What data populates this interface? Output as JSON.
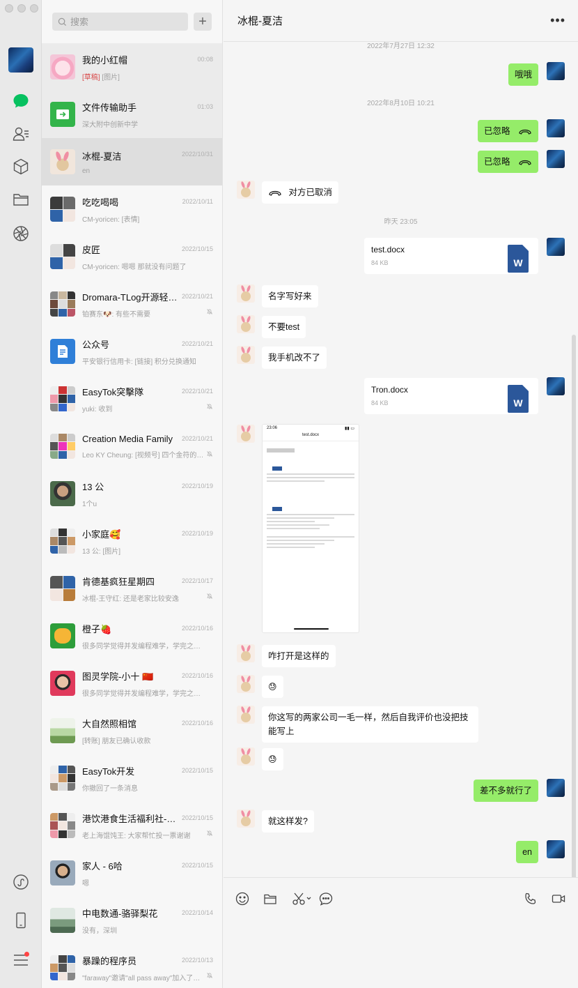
{
  "sidebar": {
    "icons": [
      "avatar",
      "chat-icon",
      "contacts-icon",
      "favorites-icon",
      "folder-icon",
      "moments-icon",
      "mini-program-icon",
      "phone-icon",
      "menu-icon"
    ]
  },
  "search": {
    "placeholder": "搜索",
    "add_label": "+"
  },
  "conversations": [
    {
      "name": "我的小红帽",
      "draft": "[草稿]",
      "preview": " [图片]",
      "time": "00:08"
    },
    {
      "name": "文件传输助手",
      "preview": "深大附中创新中学",
      "time": "01:03"
    },
    {
      "name": "冰棍-夏洁",
      "preview": "en",
      "time": "2022/10/31"
    },
    {
      "name": "吃吃喝喝",
      "preview": "CM-yoricen: [表情]",
      "time": "2022/10/11"
    },
    {
      "name": "皮匠",
      "preview": "CM-yoricen: 嗯嗯 那就没有问题了",
      "time": "2022/10/15"
    },
    {
      "name": "Dromara-TLog开源轻量…",
      "preview": "铂赛东🐶: 有些不需要",
      "time": "2022/10/21"
    },
    {
      "name": "公众号",
      "preview": "平安银行信用卡: [链接] 积分兑换通知",
      "time": "2022/10/21"
    },
    {
      "name": "EasyTok突擊隊",
      "preview": "yuki: 收到",
      "time": "2022/10/21"
    },
    {
      "name": "Creation Media Family",
      "preview": "Leo KY Cheung: [视频号] 四个金符的动态",
      "time": "2022/10/21"
    },
    {
      "name": "13 公",
      "preview": "1个u",
      "time": "2022/10/19"
    },
    {
      "name": "小家庭🥰",
      "preview": "13 公: [图片]",
      "time": "2022/10/19"
    },
    {
      "name": "肯德基疯狂星期四",
      "preview": "冰棍-王守红: 还是老家比较安逸",
      "time": "2022/10/17"
    },
    {
      "name": "橙子🍓",
      "preview": "很多同学觉得并发编程难学，学完之后工作…",
      "time": "2022/10/16"
    },
    {
      "name": "图灵学院-小十 🇨🇳",
      "preview": "很多同学觉得并发编程难学，学完之后工作…",
      "time": "2022/10/16"
    },
    {
      "name": "大自然照相馆",
      "preview": "[转账] 朋友已确认收款",
      "time": "2022/10/16"
    },
    {
      "name": "EasyTok开发",
      "preview": "你撤回了一条消息",
      "time": "2022/10/15"
    },
    {
      "name": "港饮港食生活福利社-尖…",
      "preview": "老上海馄饨王: 大家帮忙投一票谢谢",
      "time": "2022/10/15"
    },
    {
      "name": "家人 - 6哈",
      "preview": "嗯",
      "time": "2022/10/15"
    },
    {
      "name": "中电数通-骆驿梨花",
      "preview": "没有，深圳",
      "time": "2022/10/14"
    },
    {
      "name": "暴躁的程序员",
      "preview": "\"faraway\"邀请\"all pass away\"加入了群聊",
      "time": "2022/10/13"
    }
  ],
  "chat": {
    "title": "冰棍-夏洁",
    "more": "•••",
    "timestamps": [
      "2022年7月27日 12:32",
      "2022年8月10日 10:21",
      "昨天 23:05"
    ],
    "messages": [
      {
        "from": "me",
        "text": "哦哦"
      },
      {
        "from": "me",
        "text": "已忽略"
      },
      {
        "from": "me",
        "text": "已忽略"
      },
      {
        "from": "her",
        "text": "对方已取消"
      },
      {
        "from": "me",
        "file": "test.docx",
        "size": "84 KB"
      },
      {
        "from": "her",
        "text": "名字写好来"
      },
      {
        "from": "her",
        "text": "不要test"
      },
      {
        "from": "her",
        "text": "我手机改不了"
      },
      {
        "from": "me",
        "file": "Tron.docx",
        "size": "84 KB"
      },
      {
        "from": "her",
        "image": "screenshot",
        "phone_time": "23:06",
        "doc_title": "test.docx"
      },
      {
        "from": "her",
        "text": "咋打开是这样的"
      },
      {
        "from": "her",
        "emoji": "😓"
      },
      {
        "from": "her",
        "text": "你这写的两家公司一毛一样，然后自我评价也没把技能写上"
      },
      {
        "from": "her",
        "emoji": "😓"
      },
      {
        "from": "me",
        "text": "差不多就行了"
      },
      {
        "from": "her",
        "text": "就这样发?"
      },
      {
        "from": "me",
        "text": "en"
      }
    ]
  },
  "composer": {
    "tools": [
      "emoji-icon",
      "folder-icon",
      "scissors-icon",
      "chat-bubble-icon",
      "phone-icon",
      "video-icon"
    ]
  },
  "colors": {
    "my_bubble": "#95ec69",
    "her_bubble": "#ffffff",
    "active_row": "#dedede",
    "accent": "#07c160"
  }
}
